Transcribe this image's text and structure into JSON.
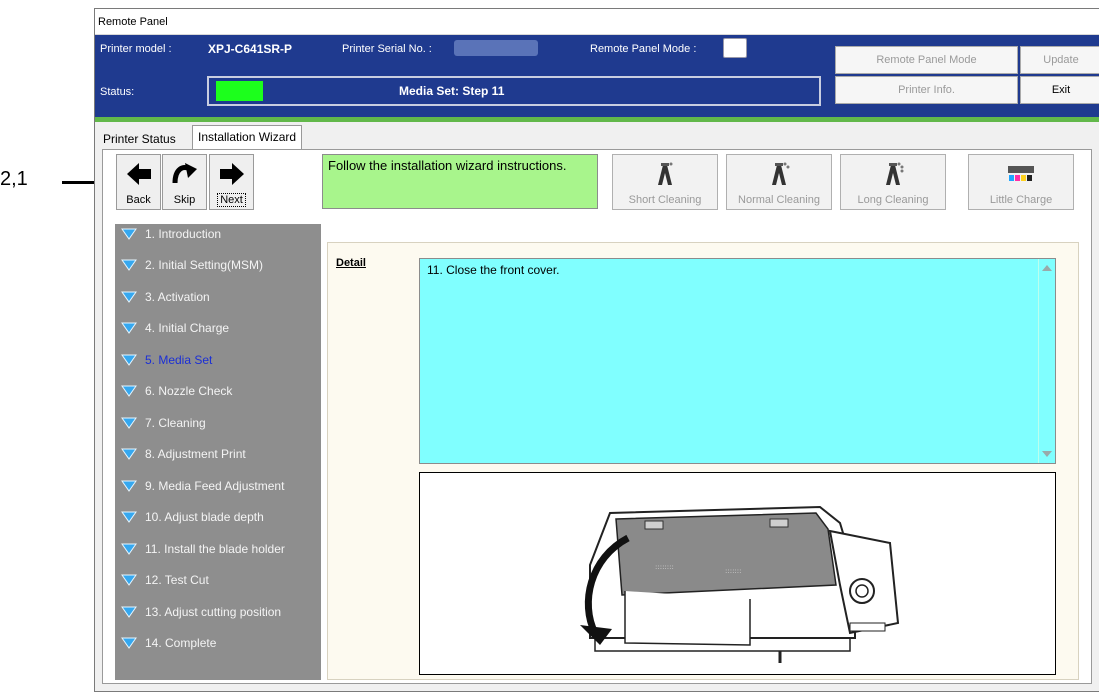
{
  "callout": {
    "label": "2,1"
  },
  "window": {
    "title": "Remote Panel"
  },
  "header": {
    "printer_model_label": "Printer model :",
    "printer_model_value": "XPJ-C641SR-P",
    "serial_label": "Printer Serial No. :",
    "mode_label": "Remote Panel Mode :",
    "status_label": "Status:",
    "status_text": "Media Set: Step 11",
    "status_color": "#1cff1c",
    "buttons": {
      "remote_panel_mode": "Remote Panel Mode",
      "update": "Update",
      "printer_info": "Printer Info.",
      "exit": "Exit"
    }
  },
  "tabs": [
    {
      "label": "Printer Status",
      "active": false
    },
    {
      "label": "Installation Wizard",
      "active": true
    }
  ],
  "toolbar": {
    "back": "Back",
    "skip": "Skip",
    "next": "Next",
    "instruction": "Follow the installation wizard instructions.",
    "short_cleaning": "Short Cleaning",
    "normal_cleaning": "Normal Cleaning",
    "long_cleaning": "Long Cleaning",
    "little_charge": "Little Charge"
  },
  "steps": [
    {
      "label": "1. Introduction",
      "current": false
    },
    {
      "label": "2. Initial Setting(MSM)",
      "current": false
    },
    {
      "label": "3. Activation",
      "current": false
    },
    {
      "label": "4. Initial Charge",
      "current": false
    },
    {
      "label": "5. Media Set",
      "current": true
    },
    {
      "label": "6. Nozzle Check",
      "current": false
    },
    {
      "label": "7. Cleaning",
      "current": false
    },
    {
      "label": "8. Adjustment Print",
      "current": false
    },
    {
      "label": "9. Media Feed Adjustment",
      "current": false
    },
    {
      "label": "10. Adjust blade depth",
      "current": false
    },
    {
      "label": "11. Install the blade holder",
      "current": false
    },
    {
      "label": "12. Test Cut",
      "current": false
    },
    {
      "label": "13. Adjust cutting position",
      "current": false
    },
    {
      "label": "14. Complete",
      "current": false
    }
  ],
  "detail": {
    "label": "Detail",
    "text": "11. Close the front cover."
  },
  "colors": {
    "header_bg": "#1f3a8f",
    "instruction_bg": "#a8f58c",
    "detail_bg": "#80ffff",
    "current_step": "#1b2fd6",
    "accent_strip": "#62b84a"
  }
}
